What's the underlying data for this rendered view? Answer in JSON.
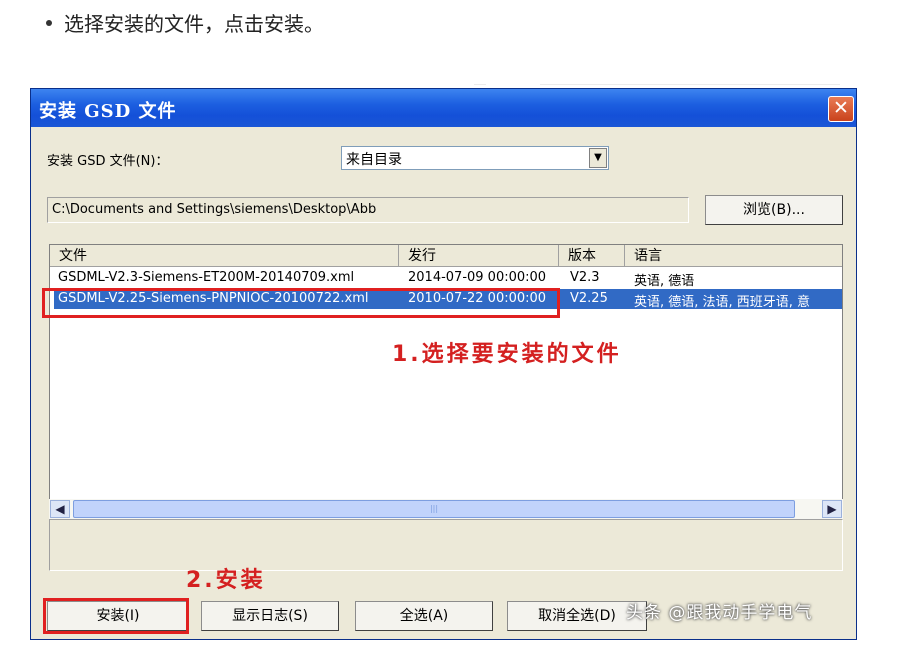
{
  "intro": {
    "text": "选择安装的文件，点击安装。"
  },
  "dialog": {
    "title": "安装 GSD 文件",
    "close_label": "✕",
    "source_label": "安装 GSD 文件(N)：",
    "source_select": "来自目录",
    "path": "C:\\Documents and Settings\\siemens\\Desktop\\Abb",
    "browse_label": "浏览(B)...",
    "columns": [
      "文件",
      "发行",
      "版本",
      "语言"
    ],
    "rows": [
      {
        "file": "GSDML-V2.3-Siemens-ET200M-20140709.xml",
        "release": "2014-07-09 00:00:00",
        "version": "V2.3",
        "language": "英语, 德语"
      },
      {
        "file": "GSDML-V2.25-Siemens-PNPNIOC-20100722.xml",
        "release": "2010-07-22 00:00:00",
        "version": "V2.25",
        "language": "英语, 德语, 法语, 西班牙语, 意"
      }
    ],
    "buttons": {
      "install": "安装(I)",
      "show_log": "显示日志(S)",
      "select_all": "全选(A)",
      "deselect_all": "取消全选(D)"
    }
  },
  "annotations": {
    "step1": "1.选择要安装的文件",
    "step2": "2.安装"
  },
  "watermark": "头条 @跟我动手学电气",
  "colors": {
    "title_bar": "#1c5fe0",
    "selection": "#316ac5",
    "annotation": "#d42020",
    "dialog_bg": "#ece9d8"
  }
}
